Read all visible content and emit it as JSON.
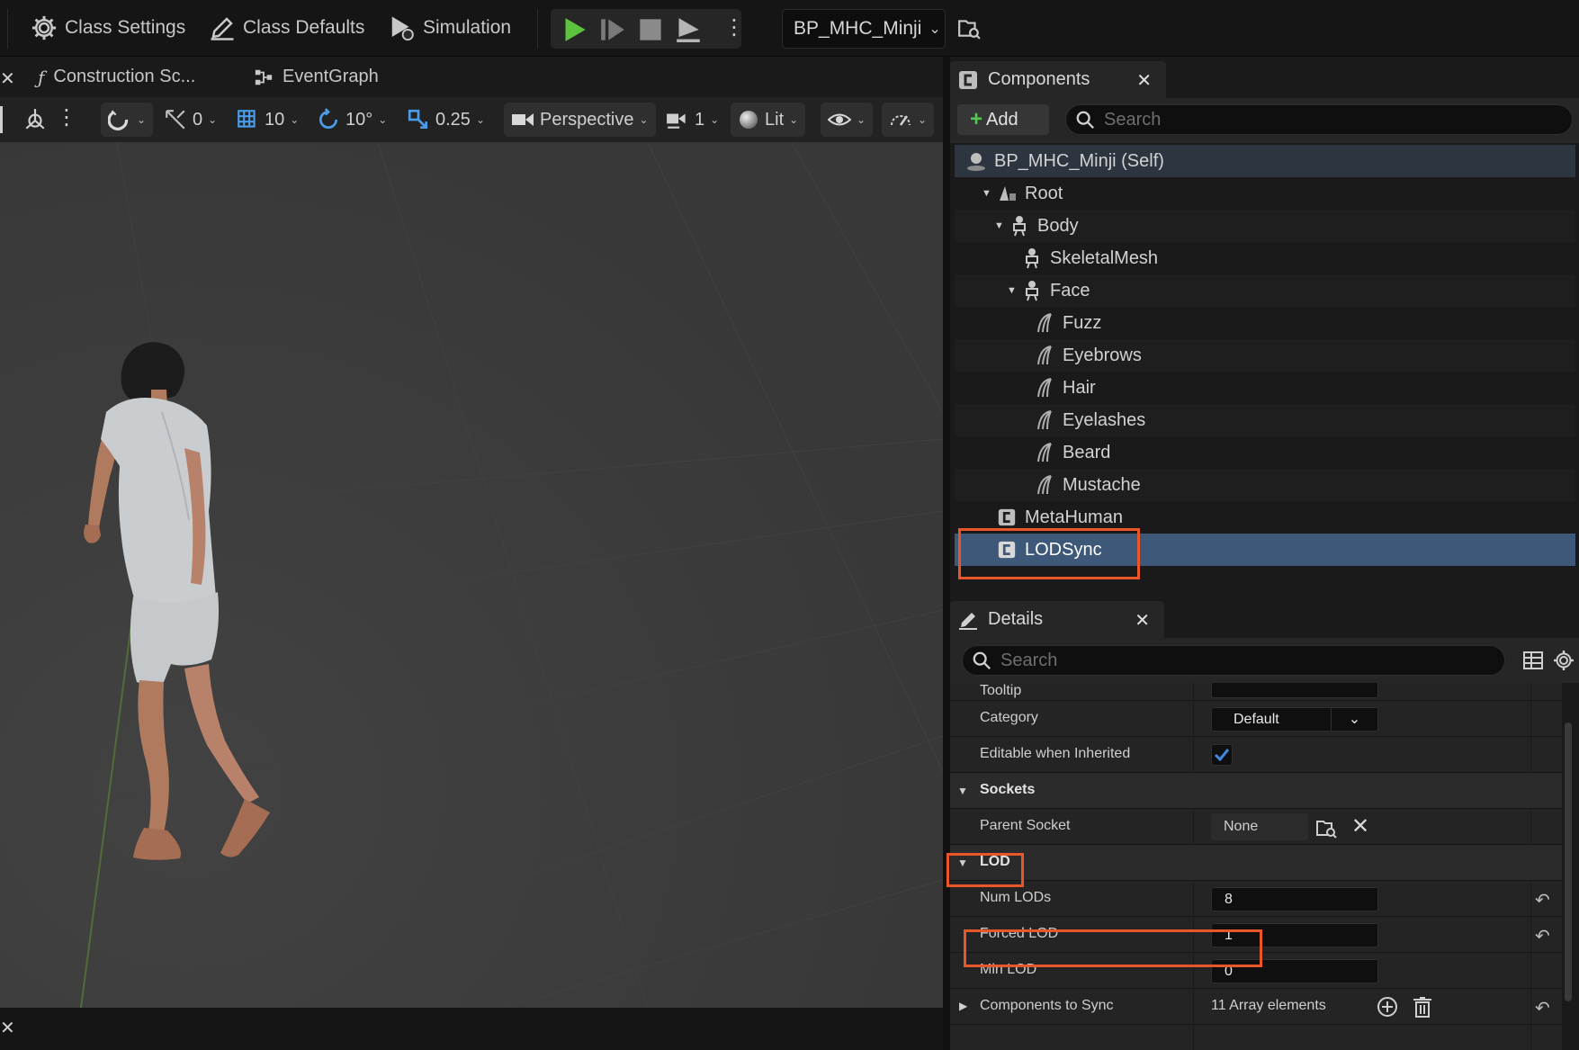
{
  "toolbar": {
    "class_settings": "Class Settings",
    "class_defaults": "Class Defaults",
    "simulation": "Simulation",
    "blueprint_select": "BP_MHC_Minji"
  },
  "tabs": {
    "construction_script": "Construction Sc...",
    "event_graph": "EventGraph"
  },
  "viewport_toolbar": {
    "translate_snap": "0",
    "grid_snap": "10",
    "rotation_snap": "10°",
    "scale_snap": "0.25",
    "view_mode": "Perspective",
    "camera_speed": "1",
    "lighting": "Lit"
  },
  "components": {
    "panel_title": "Components",
    "add_label": "Add",
    "search_placeholder": "Search",
    "tree": [
      {
        "label": "BP_MHC_Minji (Self)",
        "icon": "actor-icon"
      },
      {
        "label": "Root",
        "icon": "scene-root-icon"
      },
      {
        "label": "Body",
        "icon": "skeletal-mesh-icon"
      },
      {
        "label": "SkeletalMesh",
        "icon": "skeletal-mesh-icon"
      },
      {
        "label": "Face",
        "icon": "skeletal-mesh-icon"
      },
      {
        "label": "Fuzz",
        "icon": "groom-icon"
      },
      {
        "label": "Eyebrows",
        "icon": "groom-icon"
      },
      {
        "label": "Hair",
        "icon": "groom-icon"
      },
      {
        "label": "Eyelashes",
        "icon": "groom-icon"
      },
      {
        "label": "Beard",
        "icon": "groom-icon"
      },
      {
        "label": "Mustache",
        "icon": "groom-icon"
      },
      {
        "label": "MetaHuman",
        "icon": "component-icon"
      },
      {
        "label": "LODSync",
        "icon": "component-icon"
      }
    ]
  },
  "details": {
    "panel_title": "Details",
    "search_placeholder": "Search",
    "rows": {
      "tooltip_label": "Tooltip",
      "category_label": "Category",
      "category_value": "Default",
      "editable_label": "Editable when Inherited",
      "editable_checked": true,
      "sockets_category": "Sockets",
      "parent_socket_label": "Parent Socket",
      "parent_socket_value": "None",
      "lod_category": "LOD",
      "num_lods_label": "Num LODs",
      "num_lods_value": "8",
      "forced_lod_label": "Forced LOD",
      "forced_lod_value": "1",
      "min_lod_label": "Min LOD",
      "min_lod_value": "0",
      "components_to_sync_label": "Components to Sync",
      "components_to_sync_value": "11 Array elements"
    }
  },
  "colors": {
    "highlight": "#e8562a",
    "play_green": "#5cc43c",
    "selected_row": "#3d5878"
  }
}
